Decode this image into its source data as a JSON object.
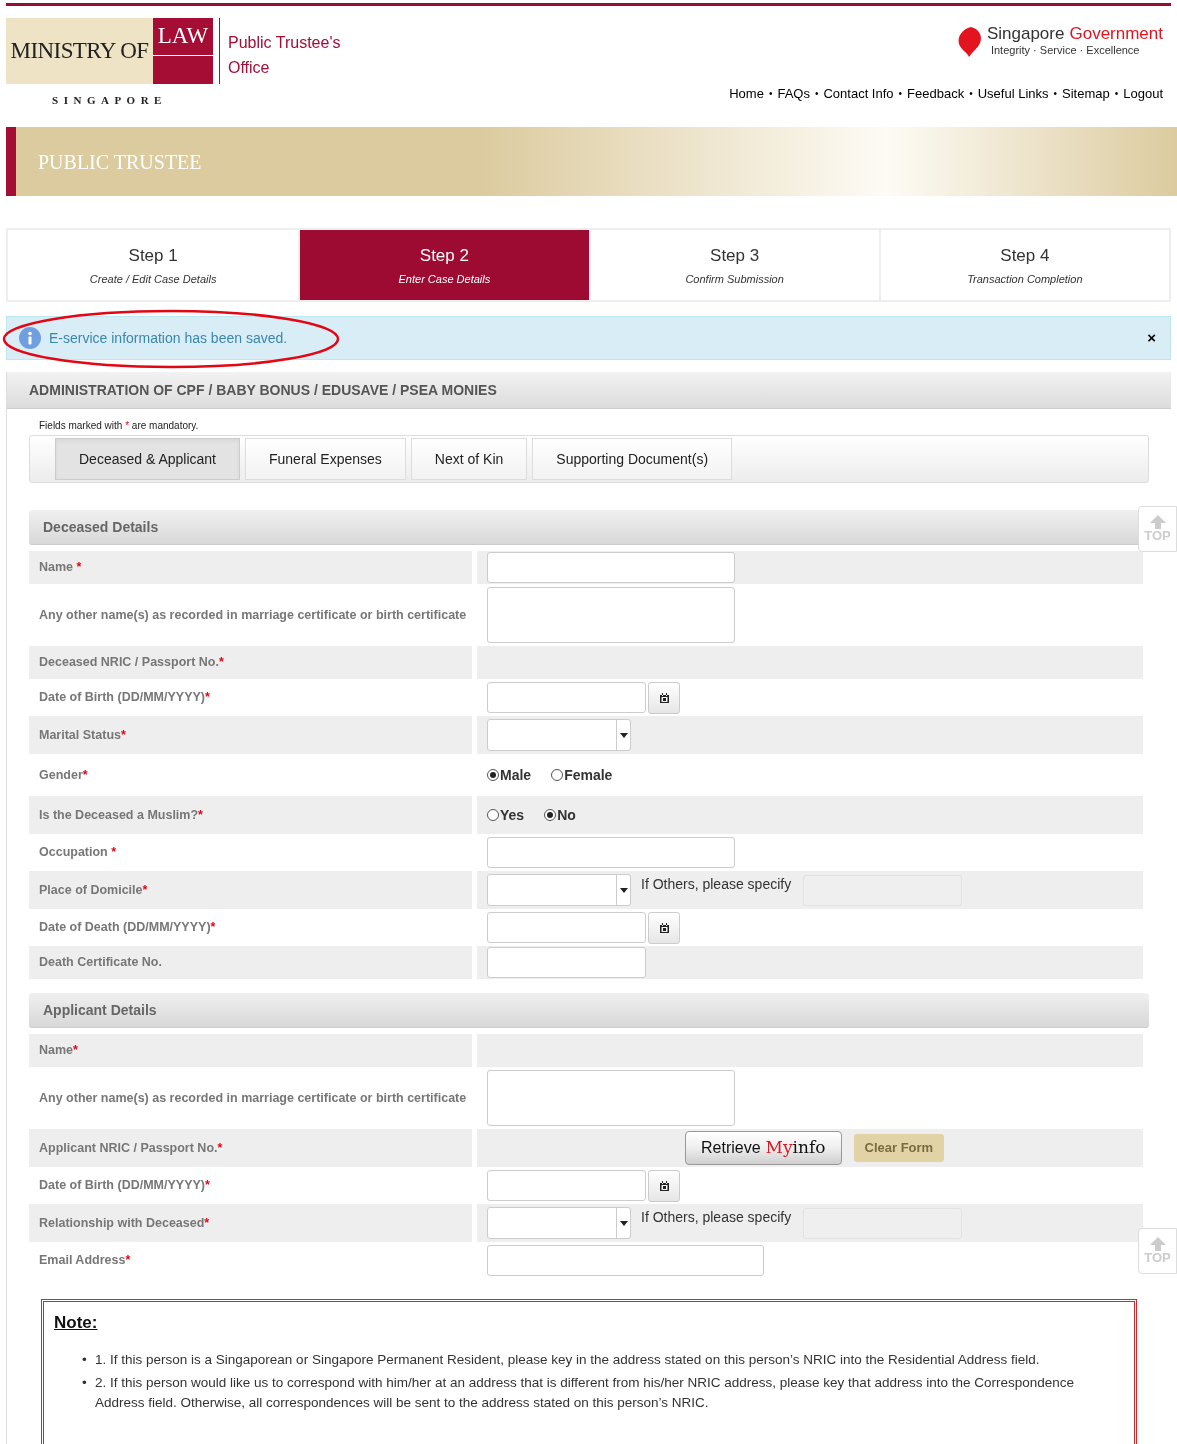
{
  "header": {
    "logo": {
      "ministry": "MINISTRY OF",
      "law": "LAW",
      "country": "SINGAPORE",
      "office_line1": "Public Trustee's",
      "office_line2": "Office"
    },
    "gov": {
      "name_a": "Singapore",
      "name_b": "Government",
      "motto": "Integrity · Service · Excellence"
    },
    "nav": {
      "separator": "•",
      "links": [
        "Home",
        "FAQs",
        "Contact Info",
        "Feedback",
        "Useful Links",
        "Sitemap",
        "Logout"
      ]
    }
  },
  "banner": {
    "title": "PUBLIC TRUSTEE"
  },
  "steps": [
    {
      "title": "Step 1",
      "subtitle": "Create / Edit Case Details",
      "selected": false
    },
    {
      "title": "Step 2",
      "subtitle": "Enter Case Details",
      "selected": true
    },
    {
      "title": "Step 3",
      "subtitle": "Confirm Submission",
      "selected": false
    },
    {
      "title": "Step 4",
      "subtitle": "Transaction Completion",
      "selected": false
    }
  ],
  "alert": {
    "message": "E-service information has been saved.",
    "close": "×",
    "circled": true
  },
  "section_title": "ADMINISTRATION OF CPF / BABY BONUS / EDUSAVE / PSEA MONIES",
  "mandatory_note": {
    "before": "Fields marked with",
    "mark": "*",
    "after": "are mandatory."
  },
  "tabs": [
    {
      "label": "Deceased & Applicant",
      "selected": true
    },
    {
      "label": "Funeral Expenses",
      "selected": false
    },
    {
      "label": "Next of Kin",
      "selected": false
    },
    {
      "label": "Supporting Document(s)",
      "selected": false
    }
  ],
  "top_buttons": [
    "TOP",
    "TOP"
  ],
  "groups": [
    {
      "title": "Deceased Details",
      "rows": [
        {
          "label": "Name",
          "mark": "*",
          "shaded": true,
          "kind": "text"
        },
        {
          "label": "Any other name(s) as recorded in marriage certificate or birth certificate",
          "shaded": false,
          "kind": "textarea"
        },
        {
          "label": "Deceased NRIC / Passport No.",
          "mark": "*",
          "shaded": true,
          "kind": "blank"
        },
        {
          "label": "Date of Birth  (DD/MM/YYYY)",
          "mark": "*",
          "shaded": false,
          "kind": "date"
        },
        {
          "label": "Marital Status",
          "mark": "*",
          "shaded": true,
          "kind": "select"
        },
        {
          "label": "Gender",
          "mark": "*",
          "shaded": false,
          "kind": "radio",
          "options": [
            {
              "label": "Male",
              "selected": true
            },
            {
              "label": "Female",
              "selected": false
            }
          ]
        },
        {
          "label": "Is the Deceased a Muslim?",
          "mark": "*",
          "shaded": true,
          "kind": "radio",
          "options": [
            {
              "label": "Yes",
              "selected": false
            },
            {
              "label": "No",
              "selected": true
            }
          ]
        },
        {
          "label": "Occupation",
          "mark": "*",
          "shaded": false,
          "kind": "text"
        },
        {
          "label": "Place of Domicile",
          "mark": "*",
          "shaded": true,
          "kind": "select_other",
          "other_label": "If Others, please specify"
        },
        {
          "label": "Date of Death  (DD/MM/YYYY)",
          "mark": "*",
          "shaded": false,
          "kind": "date"
        },
        {
          "label": "Death Certificate No.",
          "shaded": true,
          "kind": "short"
        }
      ]
    },
    {
      "title": "Applicant Details",
      "rows": [
        {
          "label": "Name",
          "mark": "*",
          "shaded": true,
          "kind": "blank"
        },
        {
          "label": "Any other name(s) as recorded in marriage certificate or birth certificate",
          "shaded": false,
          "kind": "textarea"
        },
        {
          "label": "Applicant NRIC / Passport No.",
          "mark": "*",
          "shaded": true,
          "kind": "myinfo",
          "retrieve": {
            "label": "Retrieve",
            "brand_a": "My",
            "brand_b": "info"
          },
          "clear": "Clear Form"
        },
        {
          "label": "Date of Birth  (DD/MM/YYYY)",
          "mark": "*",
          "shaded": false,
          "kind": "date"
        },
        {
          "label": "Relationship with Deceased",
          "mark": "*",
          "shaded": true,
          "kind": "select_other",
          "other_label": "If Others, please specify"
        },
        {
          "label": "Email Address",
          "mark": "*",
          "shaded": false,
          "kind": "email"
        }
      ]
    }
  ],
  "note": {
    "title": "Note:",
    "bullet": "•",
    "items": [
      "1. If this person is a Singaporean or Singapore Permanent Resident, please key in the address stated on this person’s NRIC into the Residential Address field.",
      "2. If this person would like us to correspond with him/her at an address that is different from his/her NRIC address, please key that address into the Correspondence Address field. Otherwise, all correspondences will be sent to the address stated on this person’s NRIC."
    ]
  }
}
